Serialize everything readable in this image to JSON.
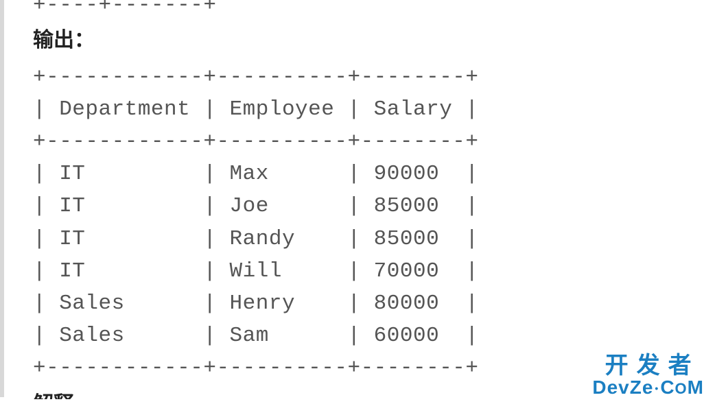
{
  "top_partial_border": "+----+-------+",
  "heading": "输出：",
  "table": {
    "border_top": "+------------+----------+--------+",
    "header": "| Department | Employee | Salary |",
    "border_mid": "+------------+----------+--------+",
    "rows": [
      "| IT         | Max      | 90000  |",
      "| IT         | Joe      | 85000  |",
      "| IT         | Randy    | 85000  |",
      "| IT         | Will     | 70000  |",
      "| Sales      | Henry    | 80000  |",
      "| Sales      | Sam      | 60000  |"
    ],
    "border_bot": "+------------+----------+--------+"
  },
  "chart_data": {
    "type": "table",
    "columns": [
      "Department",
      "Employee",
      "Salary"
    ],
    "rows": [
      [
        "IT",
        "Max",
        90000
      ],
      [
        "IT",
        "Joe",
        85000
      ],
      [
        "IT",
        "Randy",
        85000
      ],
      [
        "IT",
        "Will",
        70000
      ],
      [
        "Sales",
        "Henry",
        80000
      ],
      [
        "Sales",
        "Sam",
        60000
      ]
    ]
  },
  "bottom_partial_text": "解释",
  "watermark": {
    "line1": "开发者",
    "line2_a": "D",
    "line2_b": "evZ",
    "line2_c": "e",
    "line2_dot": "•",
    "line2_d": "C",
    "line2_e": "M"
  }
}
